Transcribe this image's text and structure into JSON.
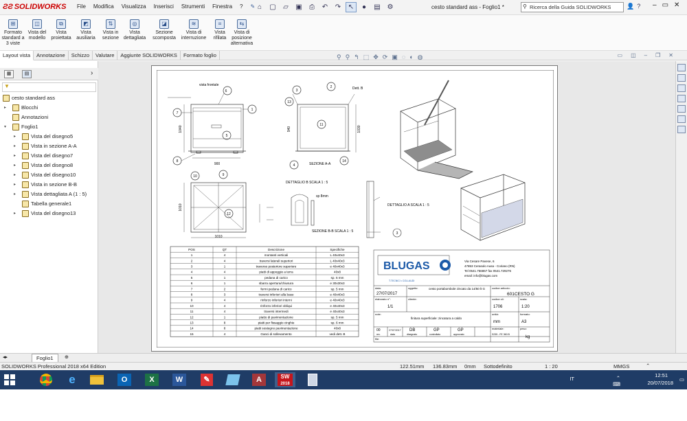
{
  "app": {
    "name": "SOLIDWORKS",
    "document_title": "cesto standard ass - Foglio1 *",
    "menus": [
      "File",
      "Modifica",
      "Visualizza",
      "Inserisci",
      "Strumenti",
      "Finestra",
      "?"
    ],
    "search_placeholder": "Ricerca della Guida SOLIDWORKS"
  },
  "commands": [
    {
      "label": "Formato standard a 3 viste",
      "icon": "3-view-icon"
    },
    {
      "label": "Vista del modello",
      "icon": "model-view-icon"
    },
    {
      "label": "Vista proiettata",
      "icon": "projected-view-icon"
    },
    {
      "label": "Vista ausiliaria",
      "icon": "auxiliary-view-icon"
    },
    {
      "label": "Vista in sezione",
      "icon": "section-view-icon"
    },
    {
      "label": "Vista dettagliata",
      "icon": "detail-view-icon"
    },
    {
      "label": "Sezione scomposta",
      "icon": "broken-out-section-icon"
    },
    {
      "label": "Vista di interruzione",
      "icon": "break-view-icon"
    },
    {
      "label": "Vista rifilata",
      "icon": "crop-view-icon"
    },
    {
      "label": "Vista di posizione alternativa",
      "icon": "alternate-position-icon"
    }
  ],
  "tabs": [
    "Layout vista",
    "Annotazione",
    "Schizzo",
    "Valutare",
    "Aggiunte SOLIDWORKS",
    "Formato foglio"
  ],
  "active_tab": "Layout vista",
  "tree": [
    {
      "label": "cesto standard ass",
      "level": 0,
      "arrow": "",
      "icon": "drawing-icon"
    },
    {
      "label": "Blocchi",
      "level": 1,
      "arrow": "▸",
      "icon": "folder-icon"
    },
    {
      "label": "Annotazioni",
      "level": 1,
      "arrow": "",
      "icon": "annotation-icon"
    },
    {
      "label": "Foglio1",
      "level": 1,
      "arrow": "▾",
      "icon": "sheet-icon"
    },
    {
      "label": "Vista del disegno5",
      "level": 2,
      "arrow": "▸",
      "icon": "drawing-view-icon"
    },
    {
      "label": "Vista in sezione A-A",
      "level": 2,
      "arrow": "▸",
      "icon": "section-view-icon"
    },
    {
      "label": "Vista del disegno7",
      "level": 2,
      "arrow": "▸",
      "icon": "drawing-view-icon"
    },
    {
      "label": "Vista del disegno8",
      "level": 2,
      "arrow": "▸",
      "icon": "drawing-view-icon"
    },
    {
      "label": "Vista del disegno10",
      "level": 2,
      "arrow": "▸",
      "icon": "drawing-view-icon"
    },
    {
      "label": "Vista in sezione B-B",
      "level": 2,
      "arrow": "▸",
      "icon": "section-view-icon"
    },
    {
      "label": "Vista dettagliata A (1 : 5)",
      "level": 2,
      "arrow": "▸",
      "icon": "detail-view-icon"
    },
    {
      "label": "Tabella generale1",
      "level": 2,
      "arrow": "",
      "icon": "table-icon"
    },
    {
      "label": "Vista del disegno13",
      "level": 2,
      "arrow": "▸",
      "icon": "drawing-view-icon"
    }
  ],
  "drawing": {
    "view_labels": {
      "front": "vista frontale",
      "section_aa": "SEZIONE A-A",
      "detail_b": "DETTAGLIO B\nSCALA 1 : 5",
      "detail_a": "DETTAGLIO A\nSCALA 1 : 5",
      "section_bb": "SEZIONE B-B\nSCALA 1 : 5",
      "dett_b": "Dett. B",
      "sp8": "sp 8mm"
    },
    "balloons_front": [
      "6",
      "1",
      "7",
      "5",
      "8"
    ],
    "balloons_section": [
      "3",
      "2",
      "13",
      "11",
      "4",
      "14"
    ],
    "balloons_top": [
      "10",
      "9",
      "12"
    ],
    "balloon_detail": "3",
    "dims": {
      "front_w": "900",
      "front_h": "1040",
      "sec_w": "1030",
      "sec_h": "940",
      "top_w": "1010",
      "top_h": "1010"
    },
    "bom": {
      "headers": [
        "POS",
        "QT",
        "Descrizione",
        "Specifiche"
      ],
      "rows": [
        [
          "1",
          "4",
          "montanti verticali",
          "L 40x40x3"
        ],
        [
          "2",
          "4",
          "traversi laterali superiori",
          "L 40x40x3"
        ],
        [
          "3",
          "1",
          "traverso posteriore superiore",
          "e 40x40x3"
        ],
        [
          "4",
          "4",
          "piatti di appoggio a terra",
          "40x8"
        ],
        [
          "5",
          "1",
          "pedana di carico",
          "sp. 5 mm"
        ],
        [
          "6",
          "1",
          "sbarra apertura/chiusura",
          "e 30x30x3"
        ],
        [
          "7",
          "2",
          "fermi pedana di carico",
          "sp. 5 mm"
        ],
        [
          "8",
          "3",
          "traversi inferiori alla base",
          "e 40x40x3"
        ],
        [
          "9",
          "4",
          "rinforzo inferiori interni",
          "e 40x40x3"
        ],
        [
          "10",
          "4",
          "rinforzo inferiori obliqui",
          "e 40x40x3"
        ],
        [
          "11",
          "4",
          "traversi intermedi",
          "e 40x40x3"
        ],
        [
          "12",
          "1",
          "piatto di pavimentazione",
          "sp. 5 mm"
        ],
        [
          "13",
          "8",
          "piatti per fissaggio cinghie",
          "sp. 6 mm"
        ],
        [
          "14",
          "8",
          "piatti sostegno pavimentazione",
          "40x8"
        ],
        [
          "15",
          "4",
          "Ganci di sollevamento",
          "vedi dett. B"
        ]
      ]
    },
    "titleblock": {
      "company": "BLUGAS",
      "company_sub": "T.TECNICI • COLLAUDI",
      "address": [
        "Via Cesare Pavese, 6",
        "47853 Cerasolo Ausa - Coriano (RN)",
        "Tel 0541.756867 fax 0541.729276",
        "email: info@blugas.com"
      ],
      "cells": {
        "data_label": "data:",
        "data_value": "27/07/2017",
        "oggetto_label": "oggetto:",
        "oggetto_value": "cesto portabombole zincato da 14/50 lt G",
        "codice_label": "codice articolo:",
        "codice_value": "601CESTO G",
        "elaborato_label": "elaborato n°:",
        "elaborato_value": "1/1",
        "cliente_label": "cliente:",
        "codice_cliente_label": "codice cli:",
        "codice_cliente_value": "1706",
        "scala_label": "scala:",
        "scala_value": "1:20",
        "note_label": "note:",
        "finitura": "finitura superficiale: zincatura a caldo",
        "unita_label": "unità:",
        "unita_value": "mm",
        "formato_label": "formato:",
        "formato_value": "A3",
        "materiale_label": "materiale:",
        "materiale_value": "S235 - FE 360 B",
        "peso_label": "peso:",
        "peso_value": "kg",
        "rev": "00",
        "rev_date": "27/07/2017",
        "dis": "DB",
        "contr": "GP",
        "appr": "GP",
        "rev_label": "rev.",
        "data2_label": "data",
        "disegnato_label": "disegnato",
        "controllato_label": "controllato",
        "approvato_label": "approvato",
        "file_label": "file:"
      }
    }
  },
  "sheet_tab": "Foglio1",
  "status": {
    "edition": "SOLIDWORKS Professional 2018 x64 Edition",
    "x": "122.51mm",
    "y": "136.83mm",
    "z": "0mm",
    "state": "Sottodefinito",
    "scale": "1 : 20",
    "units": "MMGS"
  },
  "taskbar": {
    "lang": "IT",
    "time": "12:51",
    "date": "20/07/2018",
    "apps": [
      "chrome-icon",
      "internet-explorer-icon",
      "file-explorer-icon",
      "outlook-icon",
      "excel-icon",
      "word-icon",
      "acrobat-icon",
      "paint-icon",
      "access-icon",
      "solidworks-icon",
      "calculator-icon"
    ],
    "sw_badge": "2018"
  },
  "colors": {
    "accent": "#2f5f9e",
    "solidworks_red": "#cc0000",
    "blugas": "#1c5aa8",
    "taskbar": "#1f3c66"
  }
}
